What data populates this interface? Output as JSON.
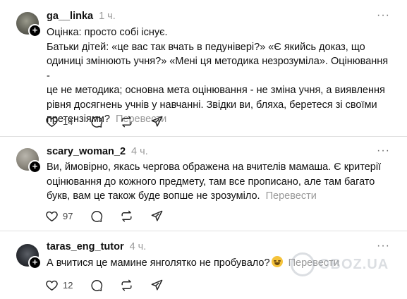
{
  "posts": [
    {
      "username": "ga__linka",
      "time": "1 ч.",
      "lines": [
        "Оцінка: просто собі існує.",
        "Батьки дітей: «це вас так вчать в педуніверi?» «Є якийсь доказ, що",
        "одиниці змінюють учня?» «Мені ця методика незрозуміла». Оцінювання -",
        "це не методика; основна мета оцінювання - не зміна учня, а виявлення",
        "рівня досягнень учнів у навчанні. Звідки ви, бляха, беретеся зі своїми"
      ],
      "last_line": "претензіями?",
      "translate": "Перевести",
      "likes": "14"
    },
    {
      "username": "scary_woman_2",
      "time": "4 ч.",
      "lines": [
        "Ви, ймовірно, якась чергова ображена на вчителів мамаша. Є критерії",
        "оцінювання до кожного предмету, там все прописано, але там багато",
        "букв, вам це також буде вопше не зрозуміло."
      ],
      "translate": "Перевести",
      "likes": "97"
    },
    {
      "username": "taras_eng_tutor",
      "time": "4 ч.",
      "text": "А вчитися це мамине янголятко не пробувало?",
      "translate": "Перевести",
      "likes": "12"
    }
  ],
  "more_label": "···",
  "watermark": "OBOZ.UA",
  "icons": [
    "heart-icon",
    "comment-icon",
    "repost-icon",
    "share-icon",
    "more-icon",
    "follow-plus-icon",
    "laughing-emoji"
  ]
}
